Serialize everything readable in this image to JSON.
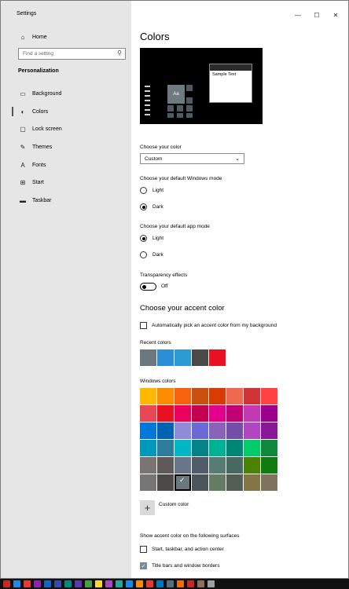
{
  "window": {
    "title": "Settings",
    "minimize_icon": "minimize-icon",
    "maximize_icon": "maximize-icon",
    "close_icon": "close-icon"
  },
  "sidebar": {
    "home": "Home",
    "search_placeholder": "Find a setting",
    "section": "Personalization",
    "items": [
      {
        "label": "Background",
        "icon": "picture-icon"
      },
      {
        "label": "Colors",
        "icon": "palette-icon",
        "selected": true
      },
      {
        "label": "Lock screen",
        "icon": "lock-screen-icon"
      },
      {
        "label": "Themes",
        "icon": "brush-icon"
      },
      {
        "label": "Fonts",
        "icon": "font-icon"
      },
      {
        "label": "Start",
        "icon": "start-icon"
      },
      {
        "label": "Taskbar",
        "icon": "taskbar-icon"
      }
    ]
  },
  "main": {
    "title": "Colors",
    "preview_text": "Sample Text",
    "preview_tile_text": "Aa",
    "choose_color": {
      "label": "Choose your color",
      "value": "Custom"
    },
    "windows_mode": {
      "label": "Choose your default Windows mode",
      "options": [
        "Light",
        "Dark"
      ],
      "selected": "Dark"
    },
    "app_mode": {
      "label": "Choose your default app mode",
      "options": [
        "Light",
        "Dark"
      ],
      "selected": "Light"
    },
    "transparency": {
      "label": "Transparency effects",
      "state": "Off"
    },
    "accent_heading": "Choose your accent color",
    "auto_pick": "Automatically pick an accent color from my background",
    "recent_label": "Recent colors",
    "recent_colors": [
      "#6b7880",
      "#2b8fd6",
      "#2c9bd1",
      "#4c4a48",
      "#e81123"
    ],
    "windows_colors_label": "Windows colors",
    "windows_colors": [
      "#ffb900",
      "#ff8c00",
      "#f7630c",
      "#ca5010",
      "#da3b01",
      "#ef6950",
      "#d13438",
      "#ff4343",
      "#e74856",
      "#e81123",
      "#ea005e",
      "#c30052",
      "#e3008c",
      "#bf0077",
      "#c239b3",
      "#9a0089",
      "#0078d7",
      "#0063b1",
      "#8e8cd8",
      "#6b69d6",
      "#8764b8",
      "#744da9",
      "#b146c2",
      "#881798",
      "#0099bc",
      "#2d7d9a",
      "#00b7c3",
      "#038387",
      "#00b294",
      "#018574",
      "#00cc6a",
      "#10893e",
      "#7a7574",
      "#5d5a58",
      "#68768a",
      "#515c6b",
      "#567c73",
      "#486860",
      "#498205",
      "#107c10",
      "#767676",
      "#4c4a48",
      "#69797e",
      "#4a5459",
      "#647c64",
      "#525e54",
      "#847545",
      "#7e735f"
    ],
    "selected_color_index": 42,
    "custom_color": "Custom color",
    "surfaces_label": "Show accent color on the following surfaces",
    "surface_start": {
      "label": "Start, taskbar, and action center",
      "checked": false
    },
    "surface_title": {
      "label": "Title bars and window borders",
      "checked": true
    }
  },
  "taskbar_colors": [
    "#c62828",
    "#1e88e5",
    "#e53935",
    "#8e24aa",
    "#1565c0",
    "#3949ab",
    "#00897b",
    "#5e35b1",
    "#43a047",
    "#fdd835",
    "#ab47bc",
    "#26a69a",
    "#1e88e5",
    "#fb8c00",
    "#e53935",
    "#0277bd",
    "#546e7a",
    "#ef6c00",
    "#c62828",
    "#8d6e63",
    "#9e9e9e"
  ]
}
